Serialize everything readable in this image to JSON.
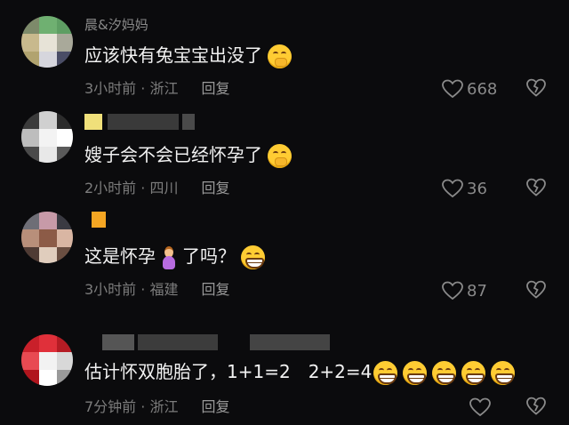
{
  "comments": [
    {
      "username": "晨&汐妈妈",
      "text": "应该快有兔宝宝出没了",
      "emoji": "shy-face-emoji",
      "meta": "3小时前 · 浙江",
      "reply_label": "回复",
      "likes": "668"
    },
    {
      "username": "",
      "text": "嫂子会不会已经怀孕了",
      "emoji": "shy-face-emoji",
      "meta": "2小时前 · 四川",
      "reply_label": "回复",
      "likes": "36"
    },
    {
      "username": "",
      "text_before": "这是怀孕",
      "text_after": "了吗？",
      "emoji": "grinning-face-emoji",
      "meta": "3小时前 · 福建",
      "reply_label": "回复",
      "likes": "87"
    },
    {
      "username": "",
      "text": "估计怀双胞胎了，1+1=2　2+2=4",
      "emoji": "grinning-face-emoji",
      "emoji_count": 5,
      "meta": "7分钟前 · 浙江",
      "reply_label": "回复",
      "likes": ""
    }
  ],
  "icons": {
    "like": "heart-outline-icon",
    "dislike": "broken-heart-icon",
    "pregnant": "pregnant-woman-emoji"
  },
  "colors": {
    "background": "#0b0b0d",
    "text_primary": "#f2f2f2",
    "text_secondary": "#7c7c7c",
    "emoji_yellow": "#ffcc33"
  }
}
